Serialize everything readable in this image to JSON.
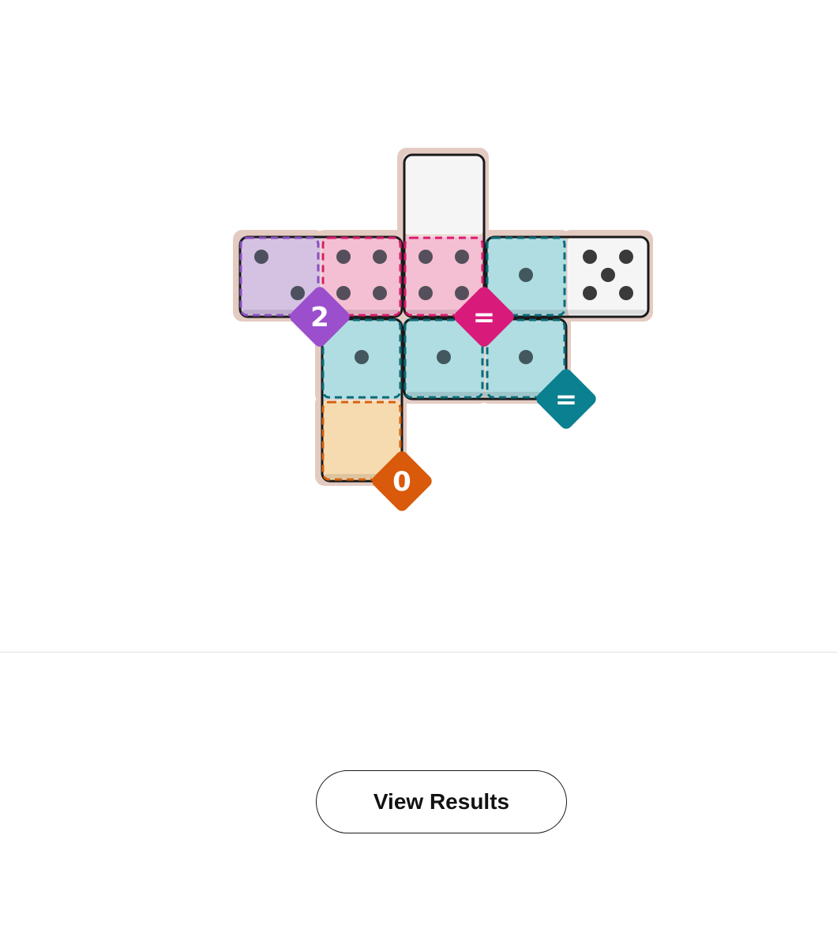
{
  "puzzle": {
    "board_color": "#e4cbc2",
    "empty_cell_color": "#f5f5f5",
    "cells": [
      {
        "row": 0,
        "col": 2,
        "region": null
      },
      {
        "row": 1,
        "col": 0,
        "region": "sum-2"
      },
      {
        "row": 1,
        "col": 1,
        "region": "equal-pink"
      },
      {
        "row": 1,
        "col": 2,
        "region": "equal-pink"
      },
      {
        "row": 1,
        "col": 3,
        "region": "equal-teal"
      },
      {
        "row": 1,
        "col": 4,
        "region": null
      },
      {
        "row": 2,
        "col": 1,
        "region": "equal-teal"
      },
      {
        "row": 2,
        "col": 2,
        "region": "equal-teal"
      },
      {
        "row": 2,
        "col": 3,
        "region": "equal-teal"
      },
      {
        "row": 3,
        "col": 1,
        "region": "sum-0"
      }
    ],
    "regions": [
      {
        "id": "sum-2",
        "fill": "#d5c2e2",
        "border": "#8a4fc0",
        "badge_color": "#9b4fcc",
        "badge_label": "2",
        "badge_row": 1,
        "badge_col": 0
      },
      {
        "id": "equal-pink",
        "fill": "#f4bfd2",
        "border": "#d81b6c",
        "badge_color": "#d81b7b",
        "badge_label": "=",
        "badge_row": 1,
        "badge_col": 2
      },
      {
        "id": "equal-teal",
        "fill": "#afdde2",
        "border": "#0b6b78",
        "badge_color": "#0a8090",
        "badge_label": "=",
        "badge_row": 2,
        "badge_col": 3
      },
      {
        "id": "sum-0",
        "fill": "#f7dbb0",
        "border": "#d3620e",
        "badge_color": "#d85a0a",
        "badge_label": "0",
        "badge_row": 3,
        "badge_col": 1
      }
    ],
    "dominoes": [
      {
        "name": "domino-4-2",
        "a": [
          1,
          0
        ],
        "b": [
          1,
          1
        ],
        "pips_a": 2,
        "pips_b": 4
      },
      {
        "name": "domino-blank-4",
        "a": [
          0,
          2
        ],
        "b": [
          1,
          2
        ],
        "pips_a": 0,
        "pips_b": 4
      },
      {
        "name": "domino-1-5",
        "a": [
          1,
          3
        ],
        "b": [
          1,
          4
        ],
        "pips_a": 1,
        "pips_b": 5
      },
      {
        "name": "domino-blank-1",
        "a": [
          3,
          1
        ],
        "b": [
          2,
          1
        ],
        "pips_a": 0,
        "pips_b": 1
      },
      {
        "name": "domino-1-1",
        "a": [
          2,
          2
        ],
        "b": [
          2,
          3
        ],
        "pips_a": 1,
        "pips_b": 1
      }
    ],
    "pip_color_on_region": "#1f2a33",
    "pip_color_plain": "#3a3a3a"
  },
  "actions": {
    "view_results_label": "View Results"
  }
}
